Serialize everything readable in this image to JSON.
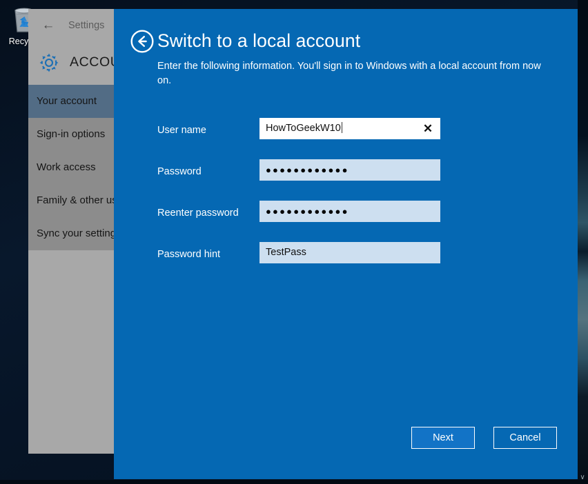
{
  "desktop": {
    "recycle_bin": {
      "icon": "recycle-bin-icon",
      "label": "Recycle"
    }
  },
  "settings_window": {
    "back_icon": "back-arrow-icon",
    "title": "Settings",
    "gear_icon": "gear-icon",
    "heading": "ACCOUNT",
    "nav_items": [
      {
        "label": "Your account",
        "selected": true
      },
      {
        "label": "Sign-in options",
        "selected": false
      },
      {
        "label": "Work access",
        "selected": false
      },
      {
        "label": "Family & other us",
        "selected": false
      },
      {
        "label": "Sync your setting",
        "selected": false
      }
    ]
  },
  "dialog": {
    "back_icon": "circled-back-arrow-icon",
    "title": "Switch to a local account",
    "subtitle": "Enter the following information. You'll sign in to Windows with a local account from now on.",
    "fields": [
      {
        "label": "User name",
        "value": "HowToGeekW10",
        "type": "text",
        "focused": true,
        "clear_icon": "clear-x-icon",
        "clear_glyph": "✕"
      },
      {
        "label": "Password",
        "value": "●●●●●●●●●●●●",
        "type": "password",
        "focused": false
      },
      {
        "label": "Reenter password",
        "value": "●●●●●●●●●●●●",
        "type": "password",
        "focused": false
      },
      {
        "label": "Password hint",
        "value": "TestPass",
        "type": "text",
        "focused": false
      }
    ],
    "buttons": {
      "next": "Next",
      "cancel": "Cancel"
    }
  },
  "scrollbar": {
    "down_arrow_glyph": "∨"
  },
  "colors": {
    "dialog_blue": "#0568b3",
    "primary_button": "#1273c6",
    "field_blue": "#cddff0",
    "settings_grey": "#8c8c8c",
    "nav_selected": "#526c85"
  }
}
